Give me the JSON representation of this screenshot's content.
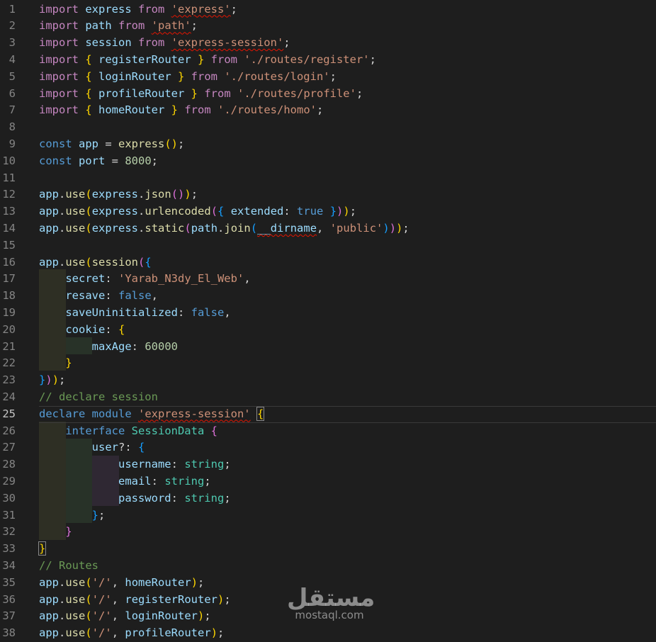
{
  "editor": {
    "current_line": 25,
    "colors": {
      "background": "#1e1e1e",
      "line_number": "#858585",
      "keyword_import": "#c586c0",
      "keyword_decl": "#569cd6",
      "variable": "#9cdcfe",
      "function": "#dcdcaa",
      "string": "#ce9178",
      "number": "#b5cea8",
      "comment": "#6a9955",
      "type": "#4ec9b0",
      "brace_gold": "#ffd700",
      "brace_purple": "#da70d6",
      "brace_blue": "#179fff",
      "punct": "#d4d4d4"
    },
    "lines": [
      {
        "n": "1",
        "tokens": [
          [
            "import ",
            "kw"
          ],
          [
            "express ",
            "var"
          ],
          [
            "from ",
            "kw"
          ],
          [
            "'express'",
            "str",
            "sq"
          ],
          [
            ";",
            "p"
          ]
        ]
      },
      {
        "n": "2",
        "tokens": [
          [
            "import ",
            "kw"
          ],
          [
            "path ",
            "var"
          ],
          [
            "from ",
            "kw"
          ],
          [
            "'path'",
            "str",
            "sq"
          ],
          [
            ";",
            "p"
          ]
        ]
      },
      {
        "n": "3",
        "tokens": [
          [
            "import ",
            "kw"
          ],
          [
            "session ",
            "var"
          ],
          [
            "from ",
            "kw"
          ],
          [
            "'express-session'",
            "str",
            "sq"
          ],
          [
            ";",
            "p"
          ]
        ]
      },
      {
        "n": "4",
        "tokens": [
          [
            "import ",
            "kw"
          ],
          [
            "{ ",
            "b1"
          ],
          [
            "registerRouter ",
            "var"
          ],
          [
            "} ",
            "b1"
          ],
          [
            "from ",
            "kw"
          ],
          [
            "'./routes/register'",
            "str"
          ],
          [
            ";",
            "p"
          ]
        ]
      },
      {
        "n": "5",
        "tokens": [
          [
            "import ",
            "kw"
          ],
          [
            "{ ",
            "b1"
          ],
          [
            "loginRouter ",
            "var"
          ],
          [
            "} ",
            "b1"
          ],
          [
            "from ",
            "kw"
          ],
          [
            "'./routes/login'",
            "str"
          ],
          [
            ";",
            "p"
          ]
        ]
      },
      {
        "n": "6",
        "tokens": [
          [
            "import ",
            "kw"
          ],
          [
            "{ ",
            "b1"
          ],
          [
            "profileRouter ",
            "var"
          ],
          [
            "} ",
            "b1"
          ],
          [
            "from ",
            "kw"
          ],
          [
            "'./routes/profile'",
            "str"
          ],
          [
            ";",
            "p"
          ]
        ]
      },
      {
        "n": "7",
        "tokens": [
          [
            "import ",
            "kw"
          ],
          [
            "{ ",
            "b1"
          ],
          [
            "homeRouter ",
            "var"
          ],
          [
            "} ",
            "b1"
          ],
          [
            "from ",
            "kw"
          ],
          [
            "'./routes/homo'",
            "str"
          ],
          [
            ";",
            "p"
          ]
        ]
      },
      {
        "n": "8",
        "tokens": []
      },
      {
        "n": "9",
        "tokens": [
          [
            "const ",
            "decl"
          ],
          [
            "app ",
            "var"
          ],
          [
            "= ",
            "p"
          ],
          [
            "express",
            "fn"
          ],
          [
            "()",
            "b1"
          ],
          [
            ";",
            "p"
          ]
        ]
      },
      {
        "n": "10",
        "tokens": [
          [
            "const ",
            "decl"
          ],
          [
            "port ",
            "var"
          ],
          [
            "= ",
            "p"
          ],
          [
            "8000",
            "num"
          ],
          [
            ";",
            "p"
          ]
        ]
      },
      {
        "n": "11",
        "tokens": []
      },
      {
        "n": "12",
        "tokens": [
          [
            "app",
            "var"
          ],
          [
            ".",
            "p"
          ],
          [
            "use",
            "fn"
          ],
          [
            "(",
            "b1"
          ],
          [
            "express",
            "var"
          ],
          [
            ".",
            "p"
          ],
          [
            "json",
            "fn"
          ],
          [
            "()",
            "b2"
          ],
          [
            ")",
            "b1"
          ],
          [
            ";",
            "p"
          ]
        ]
      },
      {
        "n": "13",
        "tokens": [
          [
            "app",
            "var"
          ],
          [
            ".",
            "p"
          ],
          [
            "use",
            "fn"
          ],
          [
            "(",
            "b1"
          ],
          [
            "express",
            "var"
          ],
          [
            ".",
            "p"
          ],
          [
            "urlencoded",
            "fn"
          ],
          [
            "(",
            "b2"
          ],
          [
            "{ ",
            "b3"
          ],
          [
            "extended",
            "var"
          ],
          [
            ": ",
            "p"
          ],
          [
            "true ",
            "decl"
          ],
          [
            "}",
            "b3"
          ],
          [
            ")",
            "b2"
          ],
          [
            ")",
            "b1"
          ],
          [
            ";",
            "p"
          ]
        ]
      },
      {
        "n": "14",
        "tokens": [
          [
            "app",
            "var"
          ],
          [
            ".",
            "p"
          ],
          [
            "use",
            "fn"
          ],
          [
            "(",
            "b1"
          ],
          [
            "express",
            "var"
          ],
          [
            ".",
            "p"
          ],
          [
            "static",
            "fn"
          ],
          [
            "(",
            "b2"
          ],
          [
            "path",
            "var"
          ],
          [
            ".",
            "p"
          ],
          [
            "join",
            "fn"
          ],
          [
            "(",
            "b3"
          ],
          [
            "__dirname",
            "var",
            "sq"
          ],
          [
            ", ",
            "p"
          ],
          [
            "'public'",
            "str"
          ],
          [
            ")",
            "b3"
          ],
          [
            ")",
            "b2"
          ],
          [
            ")",
            "b1"
          ],
          [
            ";",
            "p"
          ]
        ]
      },
      {
        "n": "15",
        "tokens": []
      },
      {
        "n": "16",
        "tokens": [
          [
            "app",
            "var"
          ],
          [
            ".",
            "p"
          ],
          [
            "use",
            "fn"
          ],
          [
            "(",
            "b1"
          ],
          [
            "session",
            "fn"
          ],
          [
            "(",
            "b2"
          ],
          [
            "{",
            "b3"
          ]
        ]
      },
      {
        "n": "17",
        "tokens": [
          [
            "    ",
            "p"
          ],
          [
            "secret",
            "var"
          ],
          [
            ": ",
            "p"
          ],
          [
            "'Yarab_N3dy_El_Web'",
            "str"
          ],
          [
            ",",
            "p"
          ]
        ]
      },
      {
        "n": "18",
        "tokens": [
          [
            "    ",
            "p"
          ],
          [
            "resave",
            "var"
          ],
          [
            ": ",
            "p"
          ],
          [
            "false",
            "decl"
          ],
          [
            ",",
            "p"
          ]
        ]
      },
      {
        "n": "19",
        "tokens": [
          [
            "    ",
            "p"
          ],
          [
            "saveUninitialized",
            "var"
          ],
          [
            ": ",
            "p"
          ],
          [
            "false",
            "decl"
          ],
          [
            ",",
            "p"
          ]
        ]
      },
      {
        "n": "20",
        "tokens": [
          [
            "    ",
            "p"
          ],
          [
            "cookie",
            "var"
          ],
          [
            ": ",
            "p"
          ],
          [
            "{",
            "b1"
          ]
        ]
      },
      {
        "n": "21",
        "tokens": [
          [
            "        ",
            "p"
          ],
          [
            "maxAge",
            "var"
          ],
          [
            ": ",
            "p"
          ],
          [
            "60000",
            "num"
          ]
        ]
      },
      {
        "n": "22",
        "tokens": [
          [
            "    ",
            "p"
          ],
          [
            "}",
            "b1"
          ]
        ]
      },
      {
        "n": "23",
        "tokens": [
          [
            "}",
            "b3"
          ],
          [
            ")",
            "b2"
          ],
          [
            ")",
            "b1"
          ],
          [
            ";",
            "p"
          ]
        ]
      },
      {
        "n": "24",
        "tokens": [
          [
            "// declare session",
            "cm"
          ]
        ]
      },
      {
        "n": "25",
        "tokens": [
          [
            "declare ",
            "decl"
          ],
          [
            "module ",
            "decl"
          ],
          [
            "'express-session'",
            "str",
            "sq"
          ],
          [
            " ",
            "p"
          ],
          [
            "{",
            "b1",
            "br"
          ]
        ]
      },
      {
        "n": "26",
        "tokens": [
          [
            "    ",
            "p"
          ],
          [
            "interface ",
            "decl"
          ],
          [
            "SessionData ",
            "type"
          ],
          [
            "{",
            "b2"
          ]
        ]
      },
      {
        "n": "27",
        "tokens": [
          [
            "        ",
            "p"
          ],
          [
            "user",
            "var"
          ],
          [
            "?: ",
            "p"
          ],
          [
            "{",
            "b3"
          ]
        ]
      },
      {
        "n": "28",
        "tokens": [
          [
            "            ",
            "p"
          ],
          [
            "username",
            "var"
          ],
          [
            ": ",
            "p"
          ],
          [
            "string",
            "type"
          ],
          [
            ";",
            "p"
          ]
        ]
      },
      {
        "n": "29",
        "tokens": [
          [
            "            ",
            "p"
          ],
          [
            "email",
            "var"
          ],
          [
            ": ",
            "p"
          ],
          [
            "string",
            "type"
          ],
          [
            ";",
            "p"
          ]
        ]
      },
      {
        "n": "30",
        "tokens": [
          [
            "            ",
            "p"
          ],
          [
            "password",
            "var"
          ],
          [
            ": ",
            "p"
          ],
          [
            "string",
            "type"
          ],
          [
            ";",
            "p"
          ]
        ]
      },
      {
        "n": "31",
        "tokens": [
          [
            "        ",
            "p"
          ],
          [
            "}",
            "b3"
          ],
          [
            ";",
            "p"
          ]
        ]
      },
      {
        "n": "32",
        "tokens": [
          [
            "    ",
            "p"
          ],
          [
            "}",
            "b2"
          ]
        ]
      },
      {
        "n": "33",
        "tokens": [
          [
            "}",
            "b1",
            "br"
          ]
        ]
      },
      {
        "n": "34",
        "tokens": [
          [
            "// Routes",
            "cm"
          ]
        ]
      },
      {
        "n": "35",
        "tokens": [
          [
            "app",
            "var"
          ],
          [
            ".",
            "p"
          ],
          [
            "use",
            "fn"
          ],
          [
            "(",
            "b1"
          ],
          [
            "'/'",
            "str"
          ],
          [
            ", ",
            "p"
          ],
          [
            "homeRouter",
            "var"
          ],
          [
            ")",
            "b1"
          ],
          [
            ";",
            "p"
          ]
        ]
      },
      {
        "n": "36",
        "tokens": [
          [
            "app",
            "var"
          ],
          [
            ".",
            "p"
          ],
          [
            "use",
            "fn"
          ],
          [
            "(",
            "b1"
          ],
          [
            "'/'",
            "str"
          ],
          [
            ", ",
            "p"
          ],
          [
            "registerRouter",
            "var"
          ],
          [
            ")",
            "b1"
          ],
          [
            ";",
            "p"
          ]
        ]
      },
      {
        "n": "37",
        "tokens": [
          [
            "app",
            "var"
          ],
          [
            ".",
            "p"
          ],
          [
            "use",
            "fn"
          ],
          [
            "(",
            "b1"
          ],
          [
            "'/'",
            "str"
          ],
          [
            ", ",
            "p"
          ],
          [
            "loginRouter",
            "var"
          ],
          [
            ")",
            "b1"
          ],
          [
            ";",
            "p"
          ]
        ]
      },
      {
        "n": "38",
        "tokens": [
          [
            "app",
            "var"
          ],
          [
            ".",
            "p"
          ],
          [
            "use",
            "fn"
          ],
          [
            "(",
            "b1"
          ],
          [
            "'/'",
            "str"
          ],
          [
            ", ",
            "p"
          ],
          [
            "profileRouter",
            "var"
          ],
          [
            ")",
            "b1"
          ],
          [
            ";",
            "p"
          ]
        ]
      }
    ]
  },
  "watermark": {
    "logo_text": "مستقل",
    "url": "mostaql.com"
  }
}
